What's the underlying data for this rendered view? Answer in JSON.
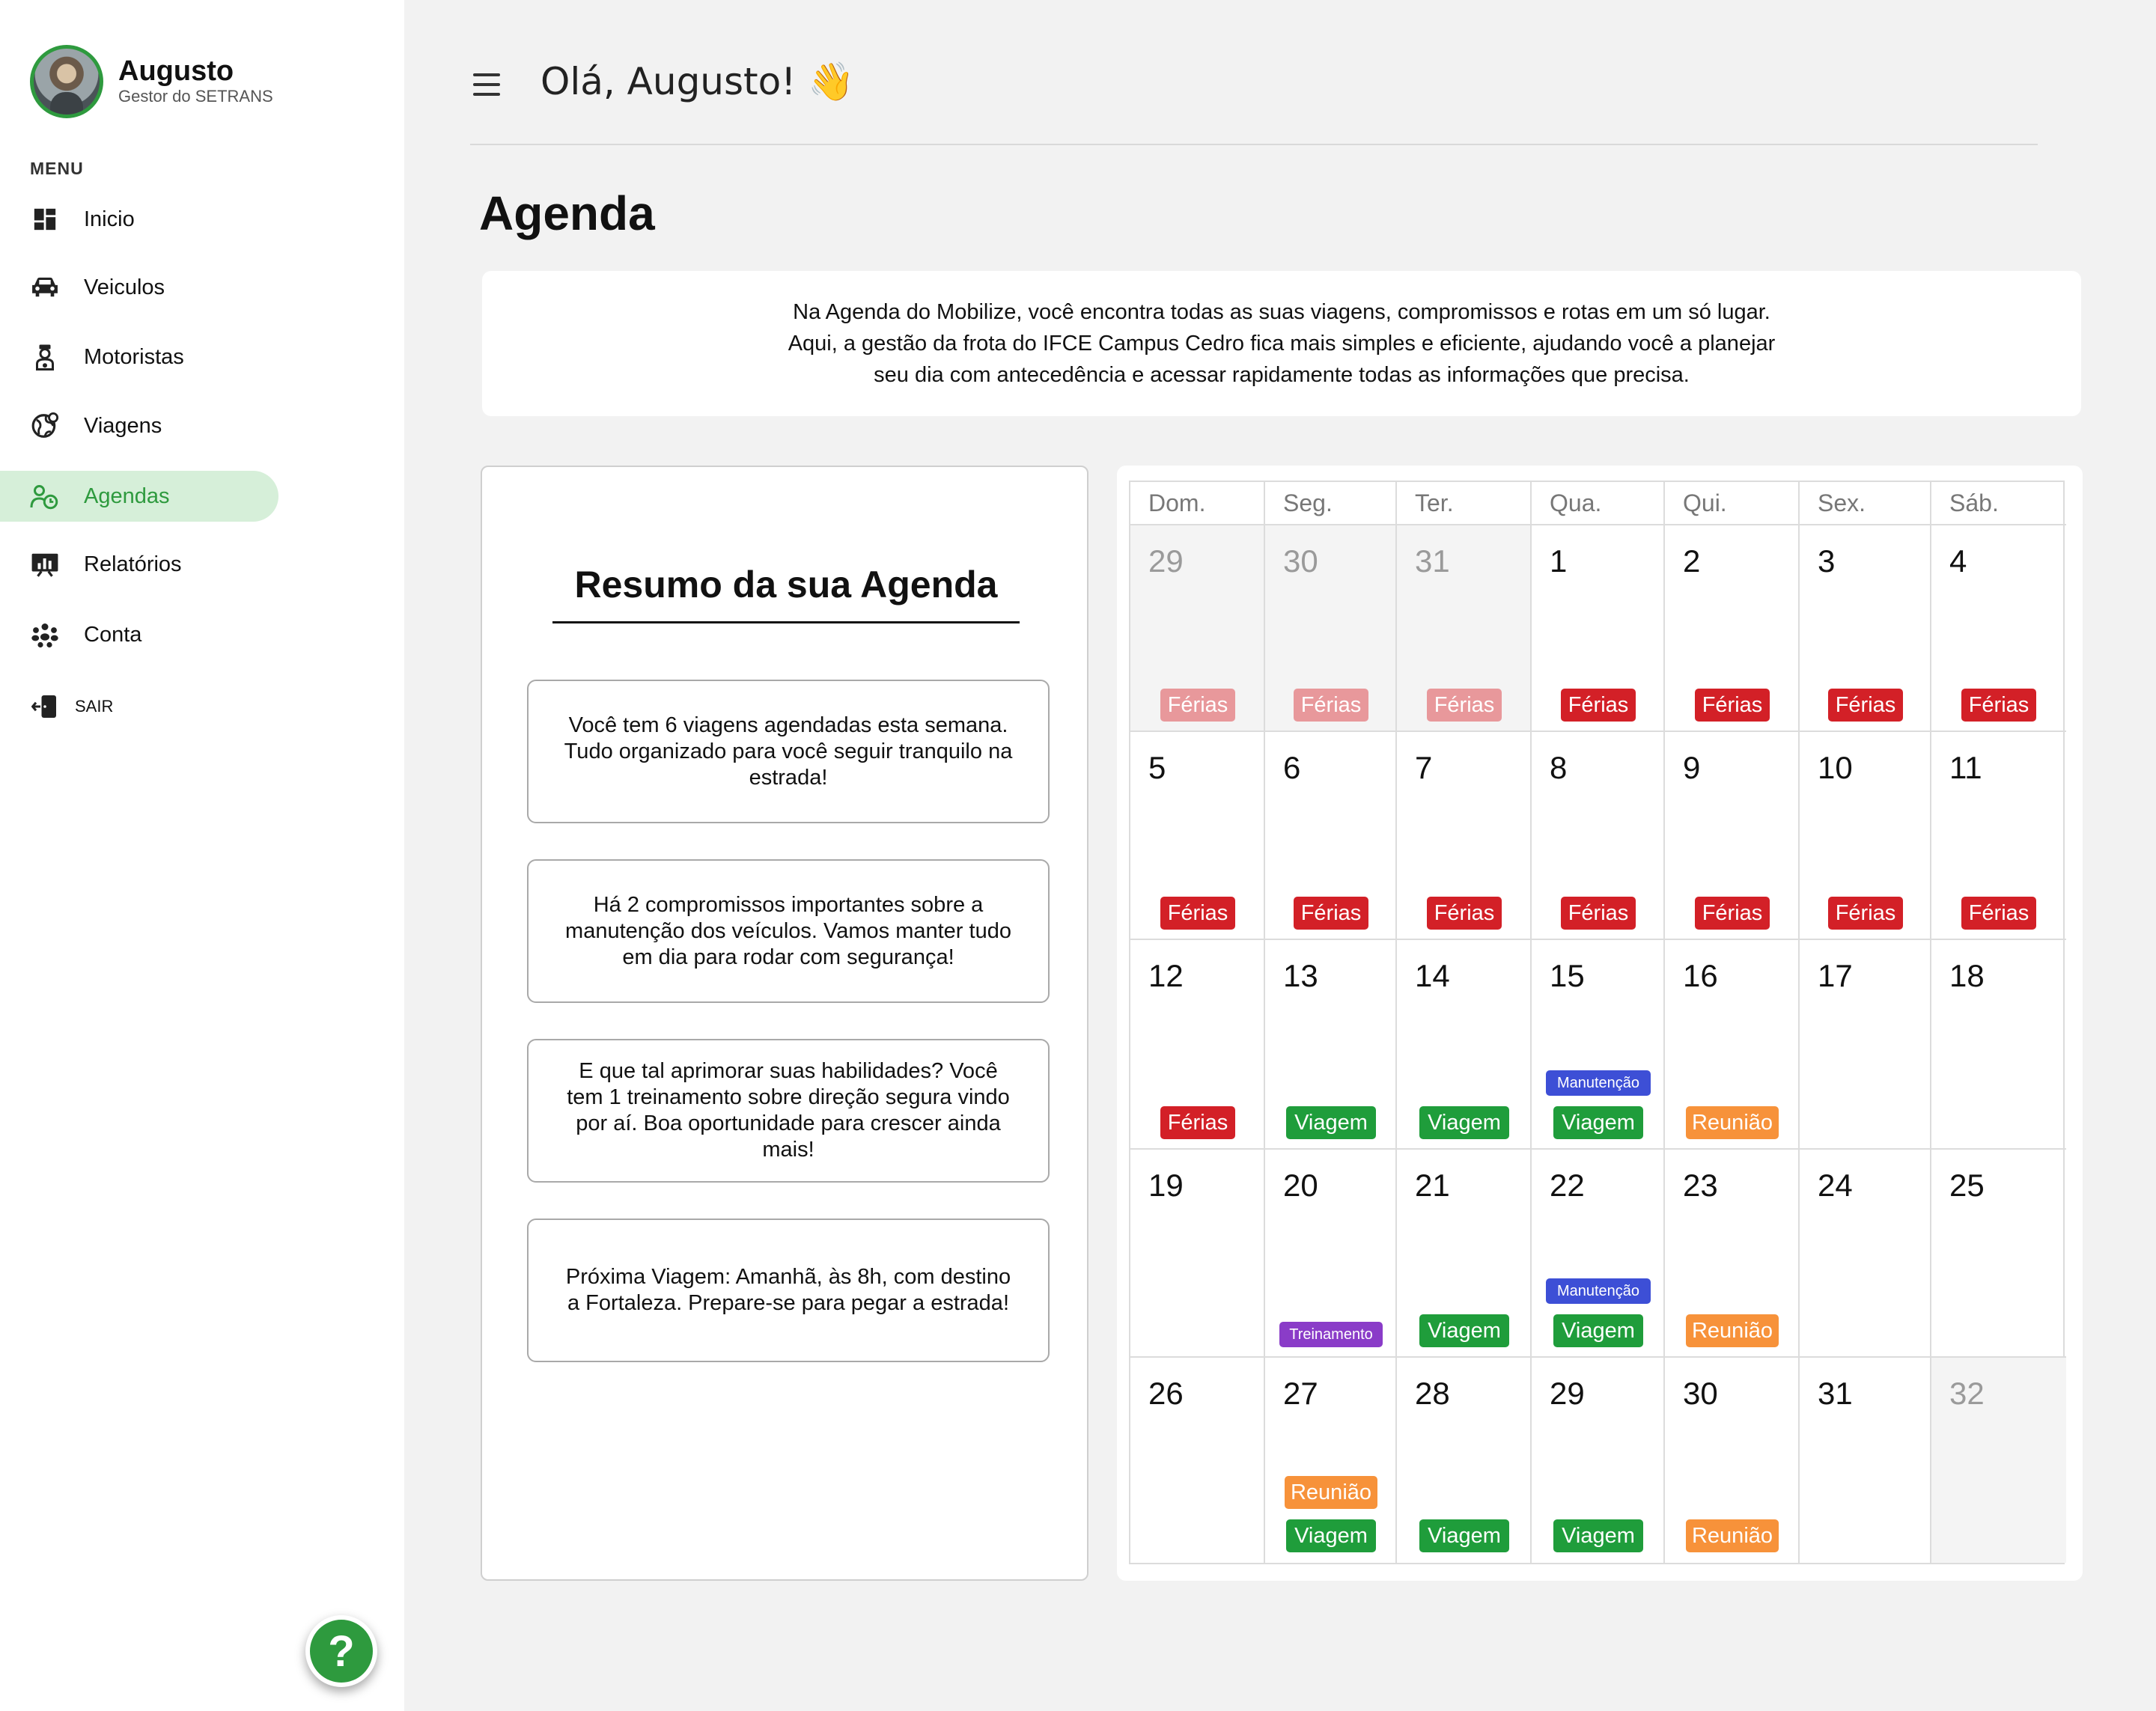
{
  "user": {
    "name": "Augusto",
    "role": "Gestor do SETRANS"
  },
  "sidebar": {
    "menu_title": "MENU",
    "items": [
      {
        "label": "Inicio",
        "icon": "dashboard-icon"
      },
      {
        "label": "Veiculos",
        "icon": "car-icon"
      },
      {
        "label": "Motoristas",
        "icon": "driver-icon"
      },
      {
        "label": "Viagens",
        "icon": "globe-icon"
      },
      {
        "label": "Agendas",
        "icon": "calendar-user-icon"
      },
      {
        "label": "Relatórios",
        "icon": "presentation-chart-icon"
      },
      {
        "label": "Conta",
        "icon": "people-icon"
      }
    ],
    "active_item": "Agendas",
    "logout_label": "SAIR",
    "help_label": "?"
  },
  "header": {
    "greeting": "Olá, Augusto! 👋"
  },
  "page": {
    "title": "Agenda",
    "intro_lines": [
      "Na Agenda do Mobilize, você encontra todas as suas viagens, compromissos e rotas em um só lugar.",
      "Aqui, a gestão da frota do IFCE Campus Cedro fica mais simples e eficiente, ajudando você a planejar",
      "seu dia com antecedência e acessar rapidamente todas as informações que precisa."
    ]
  },
  "summary": {
    "title": "Resumo da sua Agenda",
    "cards": [
      "Você tem 6 viagens agendadas esta semana. Tudo organizado para você seguir tranquilo na estrada!",
      "Há 2 compromissos importantes sobre a manutenção dos veículos. Vamos manter tudo em dia para rodar com segurança!",
      "E que tal aprimorar suas habilidades? Você tem 1 treinamento sobre direção segura vindo por aí. Boa oportunidade para crescer ainda mais!",
      "Próxima Viagem: Amanhã, às 8h, com destino a Fortaleza. Prepare-se para pegar a estrada!"
    ]
  },
  "calendar": {
    "weekdays": [
      "Dom.",
      "Seg.",
      "Ter.",
      "Qua.",
      "Qui.",
      "Sex.",
      "Sáb."
    ],
    "colors": {
      "ferias": "#d32027",
      "viagem": "#1f9d3b",
      "reuniao": "#f7923a",
      "manutencao": "#3d4fd6",
      "treinamento": "#8a3cc8"
    },
    "weeks": [
      [
        {
          "day": "29",
          "muted": true,
          "events": [
            {
              "label": "Férias",
              "type": "ferias",
              "faded": true
            }
          ]
        },
        {
          "day": "30",
          "muted": true,
          "events": [
            {
              "label": "Férias",
              "type": "ferias",
              "faded": true
            }
          ]
        },
        {
          "day": "31",
          "muted": true,
          "events": [
            {
              "label": "Férias",
              "type": "ferias",
              "faded": true
            }
          ]
        },
        {
          "day": "1",
          "events": [
            {
              "label": "Férias",
              "type": "ferias"
            }
          ]
        },
        {
          "day": "2",
          "events": [
            {
              "label": "Férias",
              "type": "ferias"
            }
          ]
        },
        {
          "day": "3",
          "events": [
            {
              "label": "Férias",
              "type": "ferias"
            }
          ]
        },
        {
          "day": "4",
          "events": [
            {
              "label": "Férias",
              "type": "ferias"
            }
          ]
        }
      ],
      [
        {
          "day": "5",
          "events": [
            {
              "label": "Férias",
              "type": "ferias"
            }
          ]
        },
        {
          "day": "6",
          "events": [
            {
              "label": "Férias",
              "type": "ferias"
            }
          ]
        },
        {
          "day": "7",
          "events": [
            {
              "label": "Férias",
              "type": "ferias"
            }
          ]
        },
        {
          "day": "8",
          "events": [
            {
              "label": "Férias",
              "type": "ferias"
            }
          ]
        },
        {
          "day": "9",
          "events": [
            {
              "label": "Férias",
              "type": "ferias"
            }
          ]
        },
        {
          "day": "10",
          "events": [
            {
              "label": "Férias",
              "type": "ferias"
            }
          ]
        },
        {
          "day": "11",
          "events": [
            {
              "label": "Férias",
              "type": "ferias"
            }
          ]
        }
      ],
      [
        {
          "day": "12",
          "events": [
            {
              "label": "Férias",
              "type": "ferias"
            }
          ]
        },
        {
          "day": "13",
          "events": [
            {
              "label": "Viagem",
              "type": "viagem"
            }
          ]
        },
        {
          "day": "14",
          "events": [
            {
              "label": "Viagem",
              "type": "viagem"
            }
          ]
        },
        {
          "day": "15",
          "events": [
            {
              "label": "Manutenção",
              "type": "manutencao"
            },
            {
              "label": "Viagem",
              "type": "viagem"
            }
          ]
        },
        {
          "day": "16",
          "events": [
            {
              "label": "Reunião",
              "type": "reuniao"
            }
          ]
        },
        {
          "day": "17",
          "events": []
        },
        {
          "day": "18",
          "events": []
        }
      ],
      [
        {
          "day": "19",
          "events": []
        },
        {
          "day": "20",
          "events": [
            {
              "label": "Treinamento",
              "type": "treinamento"
            }
          ]
        },
        {
          "day": "21",
          "events": [
            {
              "label": "Viagem",
              "type": "viagem"
            }
          ]
        },
        {
          "day": "22",
          "events": [
            {
              "label": "Manutenção",
              "type": "manutencao"
            },
            {
              "label": "Viagem",
              "type": "viagem"
            }
          ]
        },
        {
          "day": "23",
          "events": [
            {
              "label": "Reunião",
              "type": "reuniao"
            }
          ]
        },
        {
          "day": "24",
          "events": []
        },
        {
          "day": "25",
          "events": []
        }
      ],
      [
        {
          "day": "26",
          "events": []
        },
        {
          "day": "27",
          "events": [
            {
              "label": "Reunião",
              "type": "reuniao"
            },
            {
              "label": "Viagem",
              "type": "viagem"
            }
          ]
        },
        {
          "day": "28",
          "events": [
            {
              "label": "Viagem",
              "type": "viagem"
            }
          ]
        },
        {
          "day": "29",
          "events": [
            {
              "label": "Viagem",
              "type": "viagem"
            }
          ]
        },
        {
          "day": "30",
          "events": [
            {
              "label": "Reunião",
              "type": "reuniao"
            }
          ]
        },
        {
          "day": "31",
          "events": []
        },
        {
          "day": "32",
          "muted": true,
          "events": []
        }
      ]
    ]
  }
}
